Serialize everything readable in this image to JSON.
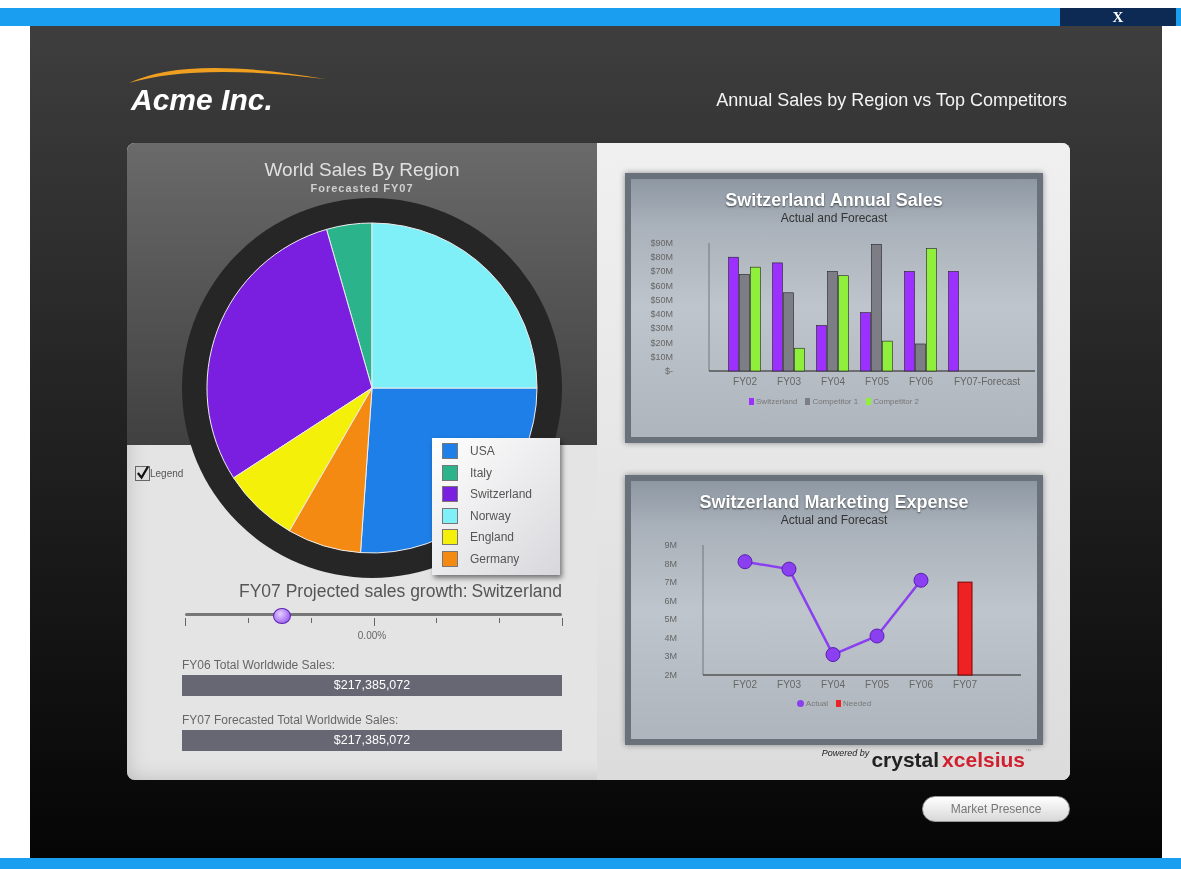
{
  "window": {
    "close_label": "X"
  },
  "header": {
    "logo": "Acme Inc.",
    "title": "Annual Sales by Region vs Top Competitors"
  },
  "pie_panel": {
    "title": "World Sales By Region",
    "subtitle": "Forecasted FY07",
    "legend_toggle": {
      "label": "Legend",
      "checked": true
    },
    "legend": [
      {
        "label": "USA",
        "color": "#1e7fe8"
      },
      {
        "label": "Italy",
        "color": "#2bb38b"
      },
      {
        "label": "Switzerland",
        "color": "#7a1ee0"
      },
      {
        "label": "Norway",
        "color": "#7ff0f8"
      },
      {
        "label": "England",
        "color": "#f5f00a"
      },
      {
        "label": "Germany",
        "color": "#f58a12"
      }
    ]
  },
  "growth": {
    "label": "FY07 Projected sales growth:",
    "region": "Switzerland",
    "level": 0.255,
    "reading": "0.00%"
  },
  "totals": [
    {
      "label": "FY06 Total Worldwide Sales:",
      "value": "$217,385,072"
    },
    {
      "label": "FY07 Forecasted Total Worldwide Sales:",
      "value": "$217,385,072"
    }
  ],
  "sales_chart": {
    "title": "Switzerland Annual Sales",
    "subtitle": "Actual and Forecast",
    "chart_data": {
      "type": "bar",
      "categories": [
        "FY02",
        "FY03",
        "FY04",
        "FY05",
        "FY06",
        "FY07-Forecast"
      ],
      "series": [
        {
          "name": "Switzerland",
          "color": "#9b30ff",
          "values": [
            80,
            76,
            32,
            41,
            70,
            70
          ]
        },
        {
          "name": "Competitor 1",
          "color": "#7d7d85",
          "values": [
            68,
            55,
            70,
            89,
            19,
            null
          ]
        },
        {
          "name": "Competitor 2",
          "color": "#8ef03a",
          "values": [
            73,
            16,
            67,
            21,
            86,
            null
          ]
        }
      ],
      "ylim": [
        0,
        90
      ],
      "yticks": [
        {
          "value": 0,
          "label": "$-"
        },
        {
          "value": 10,
          "label": "$10M"
        },
        {
          "value": 20,
          "label": "$20M"
        },
        {
          "value": 30,
          "label": "$30M"
        },
        {
          "value": 40,
          "label": "$40M"
        },
        {
          "value": 50,
          "label": "$50M"
        },
        {
          "value": 60,
          "label": "$60M"
        },
        {
          "value": 70,
          "label": "$70M"
        },
        {
          "value": 80,
          "label": "$80M"
        },
        {
          "value": 90,
          "label": "$90M"
        }
      ]
    }
  },
  "marketing_chart": {
    "title": "Switzerland Marketing Expense",
    "subtitle": "Actual and Forecast",
    "chart_data": {
      "type": "line",
      "categories": [
        "FY02",
        "FY03",
        "FY04",
        "FY05",
        "FY06",
        "FY07"
      ],
      "series": [
        {
          "name": "Actual",
          "type": "line",
          "marker": "circle",
          "color": "#8a3ff0",
          "values": [
            8.1,
            7.7,
            3.1,
            4.1,
            7.1,
            null
          ]
        },
        {
          "name": "Needed",
          "type": "bar",
          "color": "#ee2222",
          "values": [
            null,
            null,
            null,
            null,
            null,
            7.0
          ]
        }
      ],
      "ylim": [
        2,
        9
      ],
      "yticks": [
        {
          "value": 2,
          "label": "2M"
        },
        {
          "value": 3,
          "label": "3M"
        },
        {
          "value": 4,
          "label": "4M"
        },
        {
          "value": 5,
          "label": "5M"
        },
        {
          "value": 6,
          "label": "6M"
        },
        {
          "value": 7,
          "label": "7M"
        },
        {
          "value": 8,
          "label": "8M"
        },
        {
          "value": 9,
          "label": "9M"
        }
      ]
    }
  },
  "powered_by": {
    "prefix": "Powered by",
    "brand": "crystal",
    "product": "xcelsius",
    "mark": "™"
  },
  "footer_button": "Market Presence"
}
